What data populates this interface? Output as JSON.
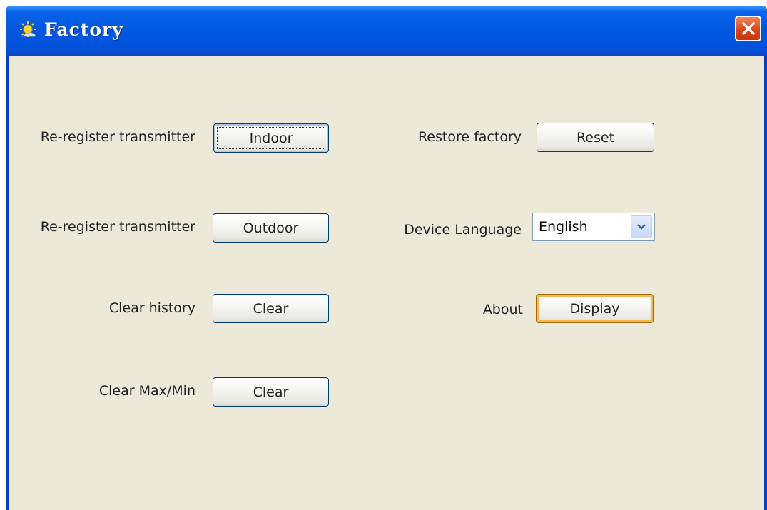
{
  "window": {
    "title": "Factory"
  },
  "rows_left": [
    {
      "label": "Re-register transmitter",
      "button": "Indoor"
    },
    {
      "label": "Re-register transmitter",
      "button": "Outdoor"
    },
    {
      "label": "Clear history",
      "button": "Clear"
    },
    {
      "label": "Clear Max/Min",
      "button": "Clear"
    }
  ],
  "rows_right": {
    "restore": {
      "label": "Restore factory",
      "button": "Reset"
    },
    "language": {
      "label": "Device Language",
      "value": "English"
    },
    "about": {
      "label": "About",
      "button": "Display"
    }
  },
  "colors": {
    "titlebar": "#0058e0",
    "client": "#ece9d8",
    "close": "#d9431a",
    "hot_border": "#f5b84a"
  }
}
